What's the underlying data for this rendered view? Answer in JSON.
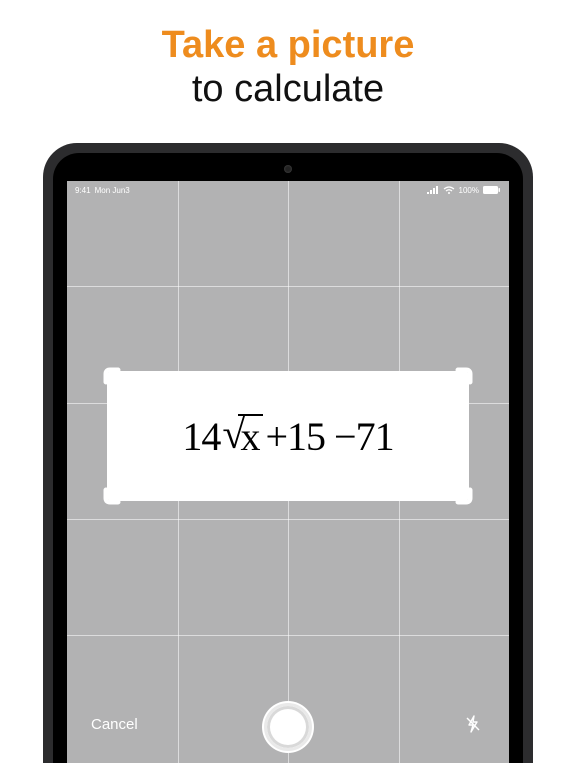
{
  "headline": {
    "line1": "Take a picture",
    "line2": "to calculate"
  },
  "status": {
    "time": "9:41",
    "date": "Mon Jun3",
    "battery_pct": "100%"
  },
  "capture": {
    "math_prefix": "14",
    "math_radicand": "x",
    "math_suffix": " +15 −71"
  },
  "toolbar": {
    "cancel_label": "Cancel"
  },
  "colors": {
    "accent": "#ee8c1e",
    "screen_bg": "#b2b2b3",
    "bezel": "#000000",
    "frame": "#2c2c2e"
  }
}
